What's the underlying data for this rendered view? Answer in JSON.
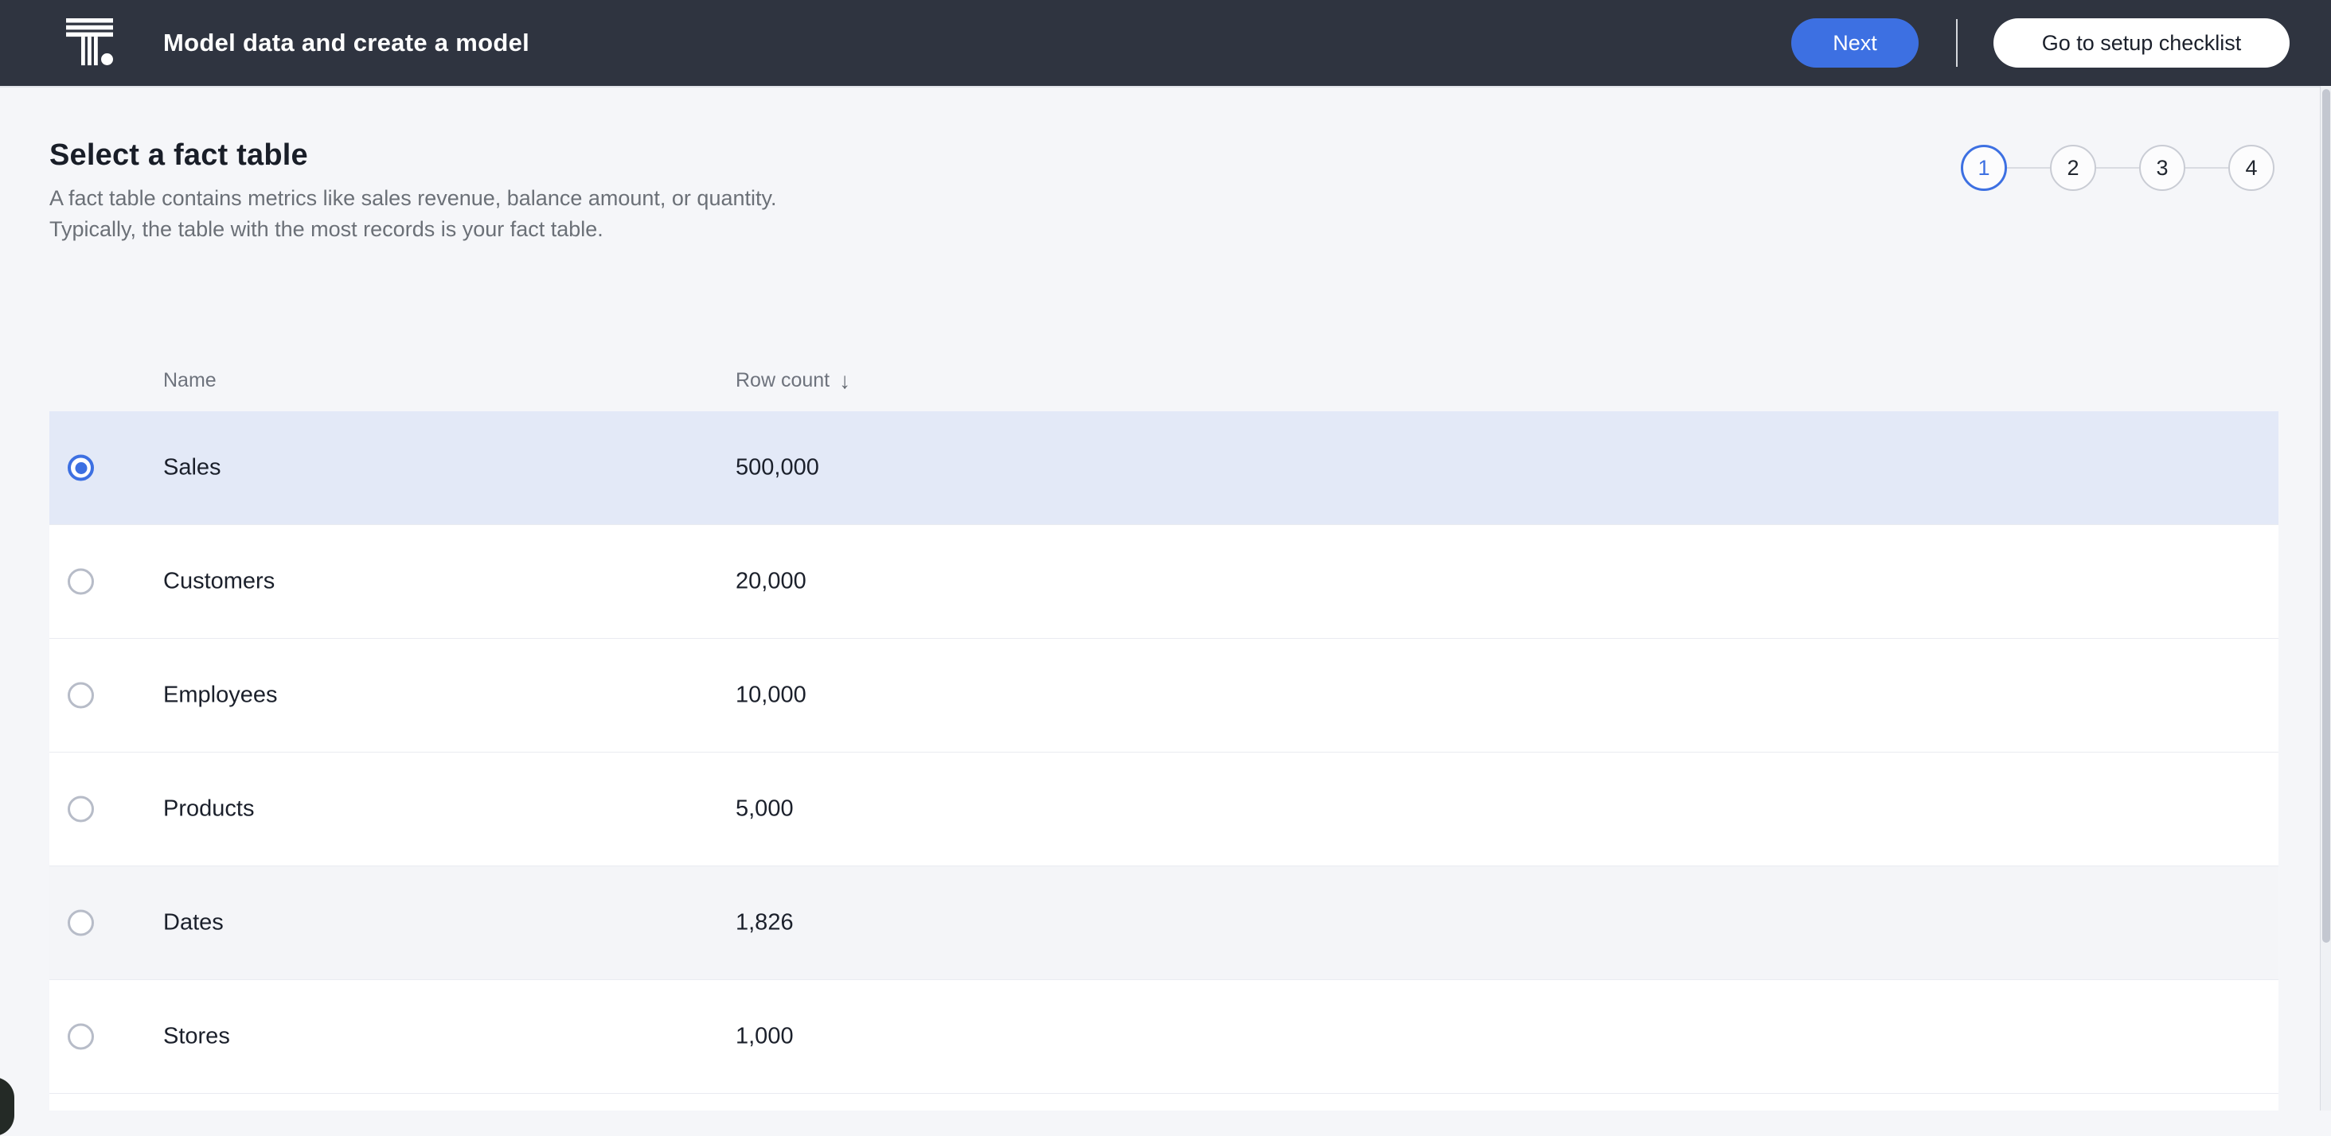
{
  "header": {
    "title": "Model data and create a model",
    "next_label": "Next",
    "checklist_label": "Go to setup checklist"
  },
  "stepper": {
    "current_step": "1",
    "steps": [
      {
        "label": "1",
        "active": true
      },
      {
        "label": "2",
        "active": false
      },
      {
        "label": "3",
        "active": false
      },
      {
        "label": "4",
        "active": false
      }
    ]
  },
  "page": {
    "heading": "Select a fact table",
    "description_line1": "A fact table contains metrics like sales revenue, balance amount, or quantity.",
    "description_line2": "Typically, the table with the most records is your fact table."
  },
  "table": {
    "columns": [
      {
        "label": "Name",
        "sortable": true
      },
      {
        "label": "Row count",
        "sortable": true,
        "sort": "desc"
      }
    ],
    "sort_indicator": "↓",
    "rows": [
      {
        "name": "Sales",
        "row_count": "500,000",
        "selected": true,
        "hovered": false
      },
      {
        "name": "Customers",
        "row_count": "20,000",
        "selected": false,
        "hovered": false
      },
      {
        "name": "Employees",
        "row_count": "10,000",
        "selected": false,
        "hovered": false
      },
      {
        "name": "Products",
        "row_count": "5,000",
        "selected": false,
        "hovered": false
      },
      {
        "name": "Dates",
        "row_count": "1,826",
        "selected": false,
        "hovered": true
      },
      {
        "name": "Stores",
        "row_count": "1,000",
        "selected": false,
        "hovered": false
      }
    ]
  },
  "colors": {
    "accent_blue": "#3D70E2",
    "header_background": "#2F3440",
    "page_background": "#F5F6F9",
    "selected_row_background": "#E3E9F7",
    "hovered_row_background": "#F4F5F8",
    "row_divider": "#E9EBF1"
  }
}
